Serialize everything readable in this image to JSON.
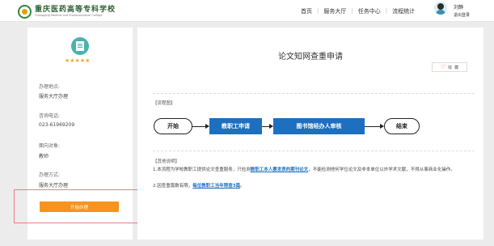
{
  "header": {
    "school_cn": "重庆医药高等专科学校",
    "school_en": "Chongqing Medical and Pharmaceutical College",
    "nav": [
      "首页",
      "服务大厅",
      "任务中心",
      "流程统计"
    ],
    "user_name": "刘静",
    "logout": "退出登录"
  },
  "sidebar": {
    "icon": "document-service-icon",
    "rating_stars": 5,
    "stars": "★★★★★",
    "location_label": "办理地点:",
    "location_value": "服务大厅办理",
    "phone_label": "咨询电话:",
    "phone_value": "023-61969209",
    "target_label": "面向对象:",
    "target_value": "教师",
    "method_label": "办理方式:",
    "method_value": "服务大厅办理",
    "start_button": "开始办理"
  },
  "main": {
    "title": "论文知网查重申请",
    "favorite_label": "收",
    "favorite_count": "藏",
    "flow_label": "【流程图】",
    "flow": {
      "start": "开始",
      "step1": "教职工申请",
      "step2": "图书馆经办人审核",
      "end": "结束"
    },
    "notes_label": "【其他说明】",
    "note1_pre": "1.本流程为学校教职工提供论文查重服务，只检测",
    "note1_link": "教职工本人要发表的期刊论文",
    "note1_post": "，不能检测他何学位论文及非本单位以外学术文献，不得从事商业化操作。",
    "note2_pre": "2.因查重篇数有限，",
    "note2_link": "每位教职工当年限查3篇",
    "note2_post": "。"
  }
}
